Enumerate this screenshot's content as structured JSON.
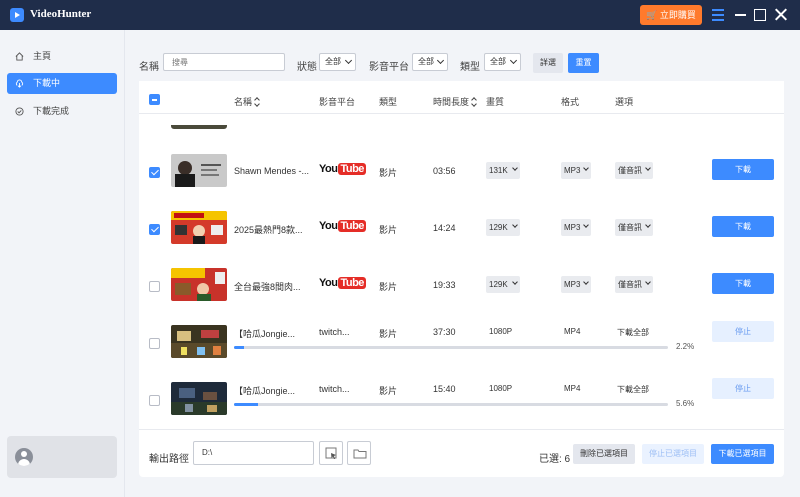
{
  "app": {
    "name": "VideoHunter",
    "buy_label": "立即購買"
  },
  "sidebar": {
    "items": [
      {
        "label": "主頁",
        "icon": "home-icon"
      },
      {
        "label": "下載中",
        "icon": "download-cloud-icon"
      },
      {
        "label": "下載完成",
        "icon": "check-circle-icon"
      }
    ]
  },
  "filters": {
    "name_label": "名稱",
    "search_placeholder": "搜尋",
    "status_label": "狀態",
    "status_value": "全部",
    "platform_label": "影音平台",
    "platform_value": "全部",
    "type_label": "類型",
    "type_value": "全部",
    "query_label": "詳選",
    "reset_label": "重置"
  },
  "table": {
    "headers": {
      "name": "名稱",
      "platform": "影音平台",
      "type": "類型",
      "duration": "時間長度",
      "quality": "畫質",
      "format": "格式",
      "options": "選項"
    },
    "rows": [
      {
        "checked": true,
        "name": "Shawn Mendes -...",
        "platform": "YouTube",
        "type": "影片",
        "duration": "03:56",
        "quality": "131K",
        "format": "MP3",
        "option": "僅音訊",
        "action": "下載"
      },
      {
        "checked": true,
        "name": "2025最熱門8款...",
        "platform": "YouTube",
        "type": "影片",
        "duration": "14:24",
        "quality": "129K",
        "format": "MP3",
        "option": "僅音訊",
        "action": "下載"
      },
      {
        "checked": false,
        "name": "全台最強8間肉...",
        "platform": "YouTube",
        "type": "影片",
        "duration": "19:33",
        "quality": "129K",
        "format": "MP3",
        "option": "僅音訊",
        "action": "下載"
      },
      {
        "checked": false,
        "name": "【哈瓜Jongie...",
        "platform": "twitch...",
        "type": "影片",
        "duration": "37:30",
        "quality": "1080P",
        "format": "MP4",
        "option": "下載全部",
        "action": "停止",
        "progress": "2.2%",
        "progress_value": 0.022
      },
      {
        "checked": false,
        "name": "【哈瓜Jongie...",
        "platform": "twitch...",
        "type": "影片",
        "duration": "15:40",
        "quality": "1080P",
        "format": "MP4",
        "option": "下載全部",
        "action": "停止",
        "progress": "5.6%",
        "progress_value": 0.056
      }
    ]
  },
  "footer": {
    "path_label": "輸出路徑",
    "path_value": "D:\\",
    "selected_text": "已選: 6",
    "delete_label": "刪除已選項目",
    "stop_label": "停止已選項目",
    "download_label": "下載已選項目"
  },
  "colors": {
    "accent": "#3d8bff",
    "titlebar": "#1f2d4a",
    "buy": "#ff7a2c",
    "youtube_red": "#e52d27"
  }
}
